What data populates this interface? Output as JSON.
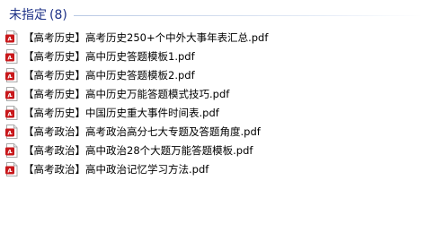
{
  "group": {
    "title": "未指定",
    "count": "(8)"
  },
  "colors": {
    "group_title": "#1e3287",
    "pdf_icon_red": "#c8171a"
  },
  "files": [
    {
      "name": "【高考历史】高考历史250+个中外大事年表汇总.pdf",
      "icon": "pdf-file-icon"
    },
    {
      "name": "【高考历史】高中历史答题模板1.pdf",
      "icon": "pdf-file-icon"
    },
    {
      "name": "【高考历史】高中历史答题模板2.pdf",
      "icon": "pdf-file-icon"
    },
    {
      "name": "【高考历史】高中历史万能答题模式技巧.pdf",
      "icon": "pdf-file-icon"
    },
    {
      "name": "【高考历史】中国历史重大事件时间表.pdf",
      "icon": "pdf-file-icon"
    },
    {
      "name": "【高考政治】高考政治高分七大专题及答题角度.pdf",
      "icon": "pdf-file-icon"
    },
    {
      "name": "【高考政治】高中政治28个大题万能答题模板.pdf",
      "icon": "pdf-file-icon"
    },
    {
      "name": "【高考政治】高中政治记忆学习方法.pdf",
      "icon": "pdf-file-icon"
    }
  ]
}
